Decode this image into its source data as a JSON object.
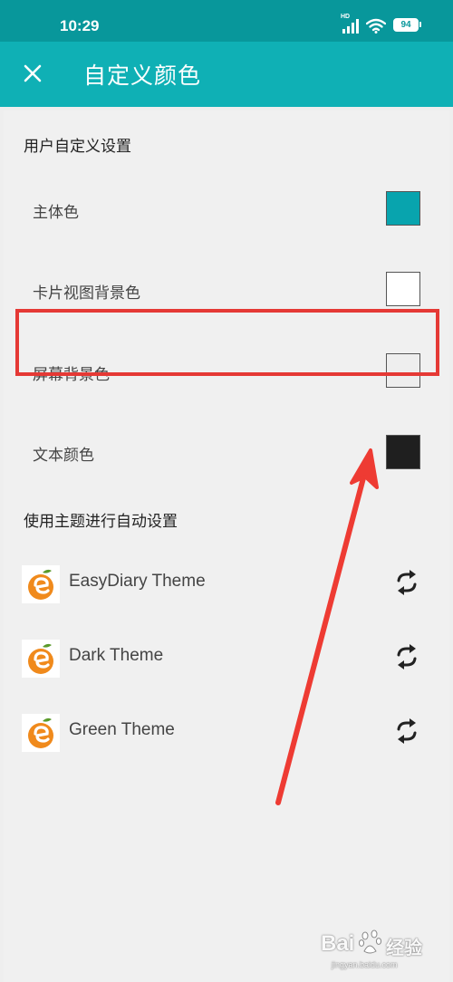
{
  "status_bar": {
    "time": "10:29",
    "network": "HD",
    "battery": "94"
  },
  "toolbar": {
    "title": "自定义颜色",
    "close_icon": "close-icon"
  },
  "custom_section": {
    "title": "用户自定义设置",
    "items": [
      {
        "label": "主体色",
        "color": "#08a4ae"
      },
      {
        "label": "卡片视图背景色",
        "color": "#ffffff"
      },
      {
        "label": "屏幕背景色",
        "color": "#eeeeee"
      },
      {
        "label": "文本颜色",
        "color": "#1f1f1f"
      }
    ]
  },
  "theme_section": {
    "title": "使用主题进行自动设置",
    "themes": [
      {
        "name": "EasyDiary Theme",
        "icon": "refresh-icon"
      },
      {
        "name": "Dark Theme",
        "icon": "refresh-icon"
      },
      {
        "name": "Green Theme",
        "icon": "refresh-icon"
      }
    ]
  },
  "annotation": {
    "color": "#e53935"
  },
  "watermark": {
    "brand": "Bai",
    "suffix": "经验",
    "domain": "jingyan.baidu.com"
  }
}
